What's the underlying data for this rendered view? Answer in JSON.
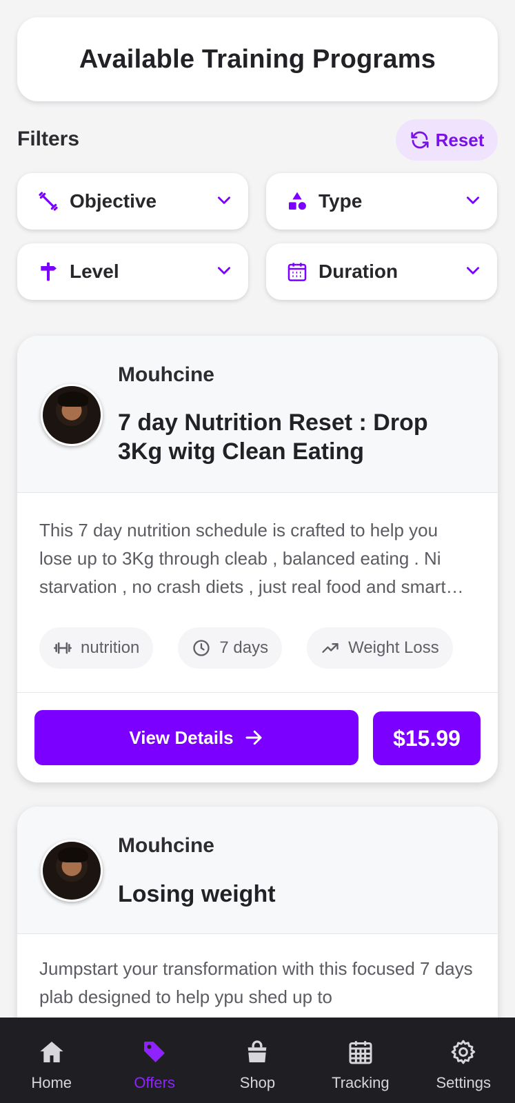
{
  "header": {
    "title": "Available Training Programs"
  },
  "filters": {
    "label": "Filters",
    "reset_label": "Reset",
    "items": [
      {
        "label": "Objective",
        "icon": "barbell-icon"
      },
      {
        "label": "Type",
        "icon": "shapes-icon"
      },
      {
        "label": "Level",
        "icon": "signpost-icon"
      },
      {
        "label": "Duration",
        "icon": "calendar-icon"
      }
    ]
  },
  "programs": [
    {
      "coach": "Mouhcine",
      "title": "7 day Nutrition Reset : Drop 3Kg witg Clean Eating",
      "description": "This 7 day nutrition schedule is crafted to help you lose up to 3Kg through cleab , balanced eating . Ni starvation , no crash diets , just real food and smart habits to reset your body.",
      "tags": {
        "category": "nutrition",
        "duration": "7 days",
        "goal": "Weight Loss"
      },
      "view_label": "View Details",
      "price": "$15.99"
    },
    {
      "coach": "Mouhcine",
      "title": "Losing weight",
      "description": "Jumpstart your transformation with this focused 7 days plab designed to help ypu shed up to"
    }
  ],
  "nav": {
    "items": [
      {
        "label": "Home",
        "icon": "home-icon"
      },
      {
        "label": "Offers",
        "icon": "tag-icon"
      },
      {
        "label": "Shop",
        "icon": "shopping-bag-icon"
      },
      {
        "label": "Tracking",
        "icon": "calendar-grid-icon"
      },
      {
        "label": "Settings",
        "icon": "gear-icon"
      }
    ],
    "active": "Offers"
  },
  "colors": {
    "accent": "#7b00ff",
    "accent_light": "#efe3fd",
    "nav_bg": "#1f1f23"
  }
}
